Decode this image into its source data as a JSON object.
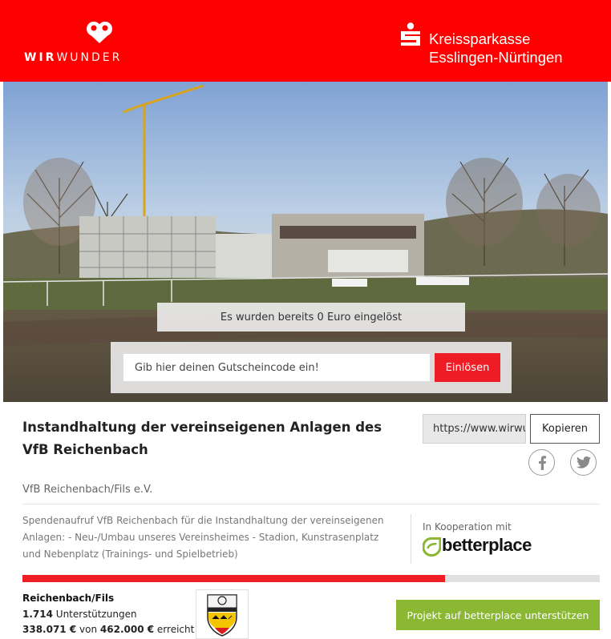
{
  "header": {
    "wirwunder_bold": "WIR",
    "wirwunder_rest": "WUNDER",
    "bank_name_line1": "Kreissparkasse",
    "bank_name_line2": "Esslingen-Nürtingen",
    "brand_color": "#ff0000"
  },
  "hero": {
    "redeemed_text": "Es wurden bereits 0 Euro eingelöst",
    "voucher_placeholder": "Gib hier deinen Gutscheincode ein!",
    "redeem_label": "Einlösen"
  },
  "project": {
    "title": "Instandhaltung der vereinseigenen Anlagen des VfB Reichenbach",
    "share_url": "https://www.wirwunder.de",
    "copy_label": "Kopieren",
    "organization": "VfB Reichenbach/Fils e.V.",
    "description": "Spendenaufruf VfB Reichenbach für die Instandhaltung der vereinseigenen Anlagen: - Neu-/Umbau unseres Vereinsheimes - Stadion, Kunstrasenplatz und Nebenplatz (Trainings- und Spielbetrieb)",
    "cooperation_label": "In Kooperation mit",
    "partner_name": "betterplace"
  },
  "stats": {
    "location": "Reichenbach/Fils",
    "supporters_count": "1.714",
    "supporters_label": "Unterstützungen",
    "raised_amount": "338.071 €",
    "von": "von",
    "goal_amount": "462.000 €",
    "reached_label": "erreicht",
    "progress_fraction": 0.732,
    "support_button": "Projekt auf betterplace unterstützen"
  },
  "icons": {
    "facebook": "facebook-icon",
    "twitter": "twitter-icon",
    "sparkasse": "sparkasse-s-icon",
    "wirwunder": "wirwunder-heart-icon",
    "betterplace": "betterplace-icon",
    "crest": "club-crest-icon"
  },
  "colors": {
    "accent_red": "#ee1c25",
    "support_green": "#8ab833",
    "progress_bg": "#e0e0e0"
  }
}
